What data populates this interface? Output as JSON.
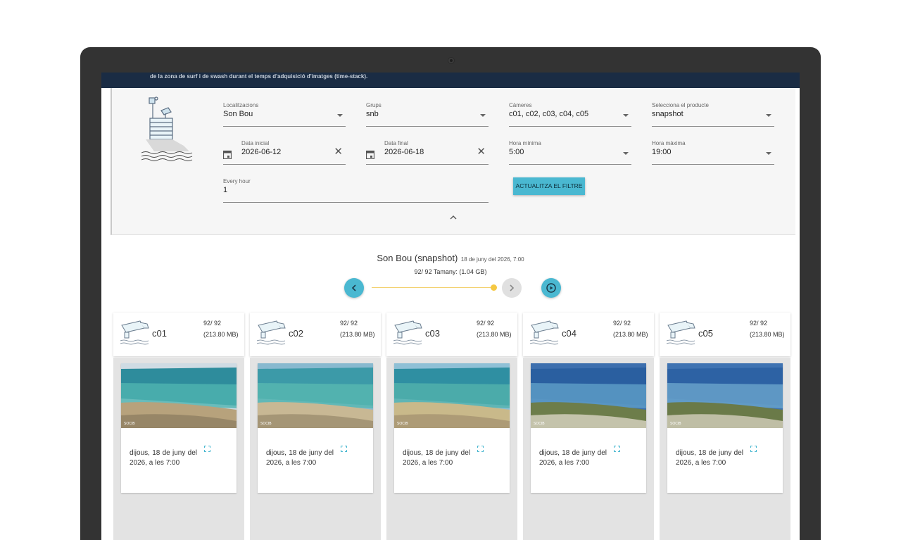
{
  "banner": {
    "text": "de la zona de surf i de swash durant el temps d'adquisició d'imatges (time-stack)."
  },
  "filters": {
    "localitzacions": {
      "label": "Localitzacions",
      "value": "Son Bou"
    },
    "grups": {
      "label": "Grups",
      "value": "snb"
    },
    "cameres": {
      "label": "Càmeres",
      "value": "c01, c02, c03, c04, c05"
    },
    "producte": {
      "label": "Selecciona el producte",
      "value": "snapshot"
    },
    "data_inicial": {
      "label": "Data inicial",
      "value": "2026-06-12"
    },
    "data_final": {
      "label": "Data final",
      "value": "2026-06-18"
    },
    "hora_minima": {
      "label": "Hora mínima",
      "value": "5:00"
    },
    "hora_maxima": {
      "label": "Hora màxima",
      "value": "19:00"
    },
    "every_hour": {
      "label": "Every hour",
      "value": "1"
    },
    "update_button": "ACTUALITZA EL FILTRE"
  },
  "summary": {
    "title": "Son Bou (snapshot)",
    "date": "18 de juny del 2026, 7:00",
    "size_line": "92/ 92 Tamany: (1.04 GB)",
    "slider_position": 1.0
  },
  "colors": {
    "accent": "#4ab8d1",
    "slider": "#f5c842",
    "banner": "#1a2c44",
    "laptop": "#333333"
  },
  "cameras": [
    {
      "name": "c01",
      "count": "92/ 92",
      "size": "(213.80 MB)",
      "date": "dijous, 18 de juny del 2026, a les 7:00"
    },
    {
      "name": "c02",
      "count": "92/ 92",
      "size": "(213.80 MB)",
      "date": "dijous, 18 de juny del 2026, a les 7:00"
    },
    {
      "name": "c03",
      "count": "92/ 92",
      "size": "(213.80 MB)",
      "date": "dijous, 18 de juny del 2026, a les 7:00"
    },
    {
      "name": "c04",
      "count": "92/ 92",
      "size": "(213.80 MB)",
      "date": "dijous, 18 de juny del 2026, a les 7:00"
    },
    {
      "name": "c05",
      "count": "92/ 92",
      "size": "(213.80 MB)",
      "date": "dijous, 18 de juny del 2026, a les 7:00"
    }
  ],
  "watermark": "SOCIB",
  "icons": {
    "calendar": "calendar-icon",
    "clear": "clear-icon",
    "dropdown": "chevron-down-icon",
    "collapse": "chevron-up-icon",
    "prev": "chevron-left-icon",
    "next": "chevron-right-icon",
    "play": "play-circle-icon",
    "expand": "fullscreen-icon",
    "camera": "camera-icon"
  }
}
